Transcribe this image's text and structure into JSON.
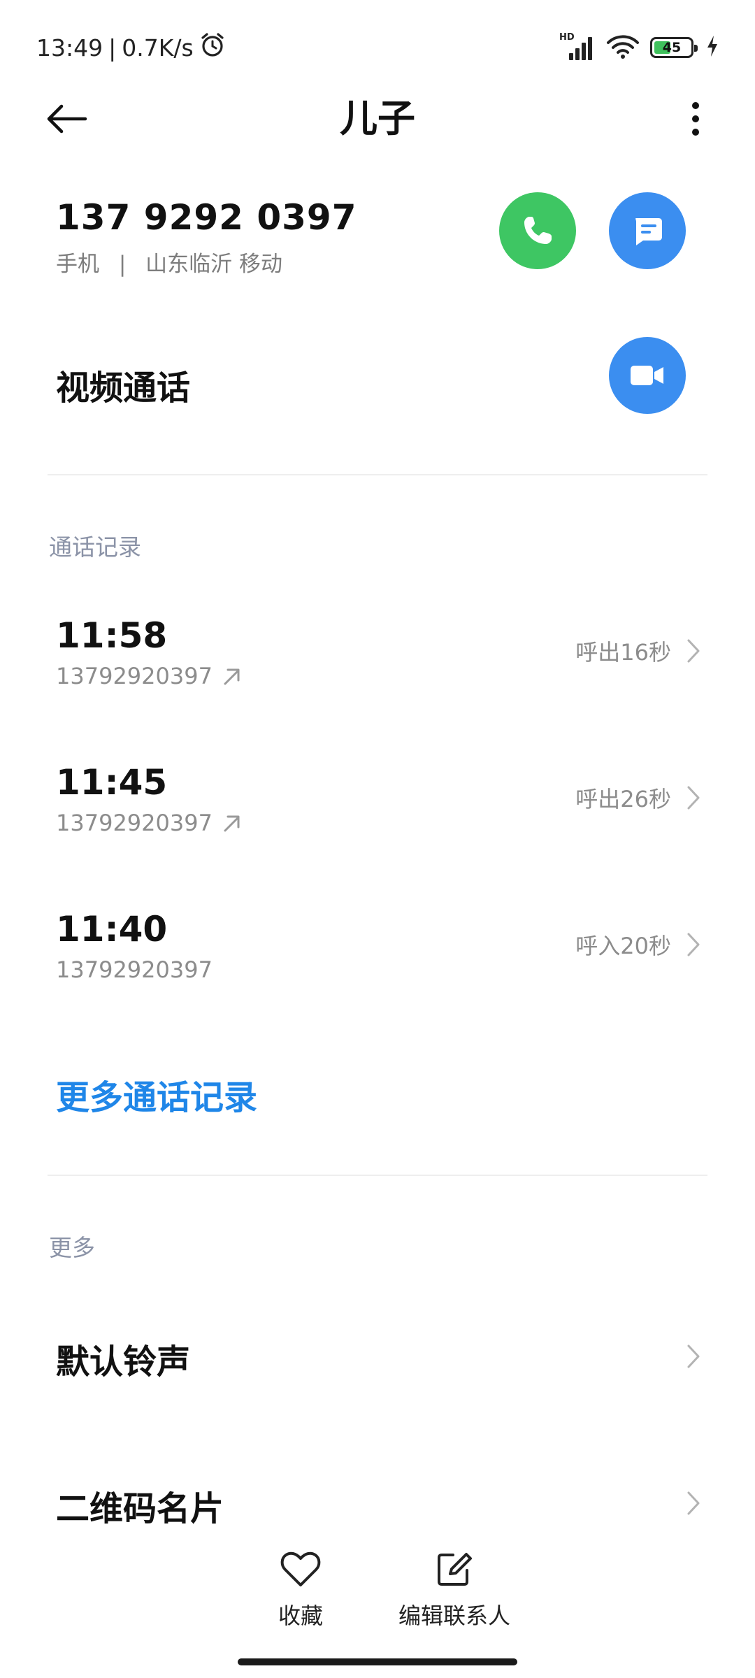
{
  "status_bar": {
    "time": "13:49",
    "separator": "|",
    "speed": "0.7K/s",
    "network_badge": "HD",
    "battery_level": "45",
    "battery_fraction": 0.45,
    "icons": [
      "alarm-icon",
      "signal-icon",
      "wifi-icon",
      "battery-icon",
      "charging-icon"
    ]
  },
  "header": {
    "title": "儿子"
  },
  "contact": {
    "phone_number": "137 9292 0397",
    "phone_type": "手机",
    "divider": "|",
    "location": "山东临沂 移动"
  },
  "video": {
    "label": "视频通话"
  },
  "call_log": {
    "heading": "通话记录",
    "entries": [
      {
        "time": "11:58",
        "number": "13792920397",
        "direction": "outgoing",
        "detail": "呼出16秒"
      },
      {
        "time": "11:45",
        "number": "13792920397",
        "direction": "outgoing",
        "detail": "呼出26秒"
      },
      {
        "time": "11:40",
        "number": "13792920397",
        "direction": "incoming",
        "detail": "呼入20秒"
      }
    ],
    "more_link": "更多通话记录"
  },
  "more_section": {
    "heading": "更多",
    "items": [
      {
        "label": "默认铃声"
      },
      {
        "label": "二维码名片"
      }
    ]
  },
  "bottom_bar": {
    "favorite_label": "收藏",
    "edit_label": "编辑联系人"
  },
  "colors": {
    "call_green": "#3ec663",
    "action_blue": "#3b8ef0",
    "link_blue": "#1f86e8",
    "battery_green": "#3fc15c",
    "section_gray": "#8b93a7"
  }
}
